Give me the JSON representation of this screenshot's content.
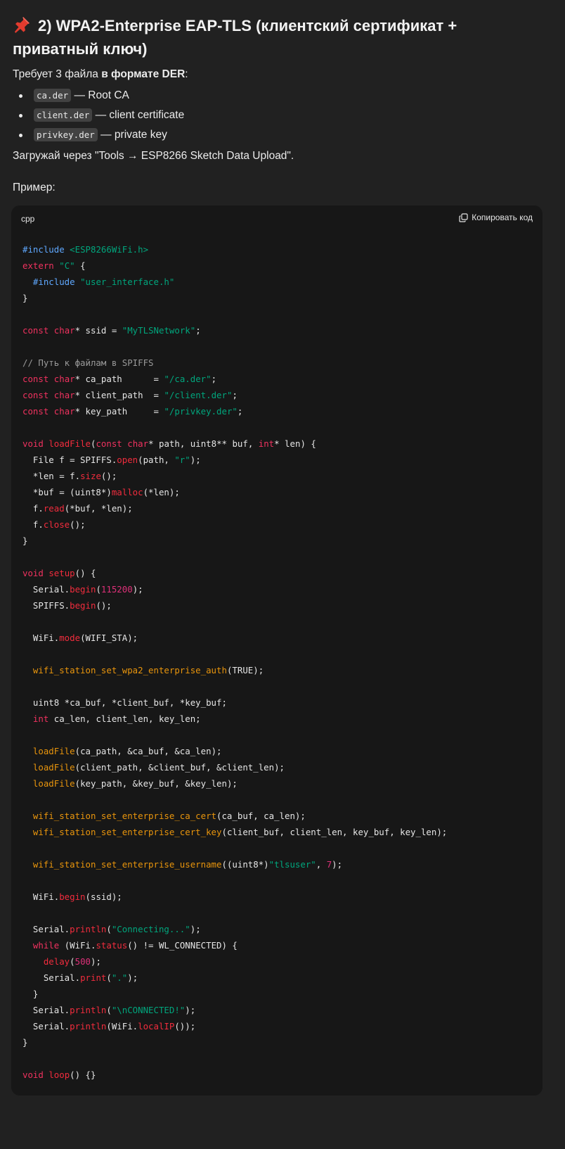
{
  "heading": {
    "icon": "pushpin-icon",
    "text": "2) WPA2-Enterprise EAP-TLS (клиентский сертификат + приватный ключ)"
  },
  "intro": {
    "prefix": "Требует 3 файла ",
    "bold": "в формате DER",
    "suffix": ":"
  },
  "files": [
    {
      "name": "ca.der",
      "desc": " — Root CA"
    },
    {
      "name": "client.der",
      "desc": " — client certificate"
    },
    {
      "name": "privkey.der",
      "desc": " — private key"
    }
  ],
  "upload_note": "Загружай через \"Tools → ESP8266 Sketch Data Upload\".",
  "example_label": "Пример:",
  "code_block": {
    "language": "cpp",
    "copy_label": "Копировать код",
    "lines": [
      "#include <ESP8266WiFi.h>",
      "extern \"C\" {",
      "  #include \"user_interface.h\"",
      "}",
      "",
      "const char* ssid = \"MyTLSNetwork\";",
      "",
      "// Путь к файлам в SPIFFS",
      "const char* ca_path      = \"/ca.der\";",
      "const char* client_path  = \"/client.der\";",
      "const char* key_path     = \"/privkey.der\";",
      "",
      "void loadFile(const char* path, uint8** buf, int* len) {",
      "  File f = SPIFFS.open(path, \"r\");",
      "  *len = f.size();",
      "  *buf = (uint8*)malloc(*len);",
      "  f.read(*buf, *len);",
      "  f.close();",
      "}",
      "",
      "void setup() {",
      "  Serial.begin(115200);",
      "  SPIFFS.begin();",
      "",
      "  WiFi.mode(WIFI_STA);",
      "",
      "  wifi_station_set_wpa2_enterprise_auth(TRUE);",
      "",
      "  uint8 *ca_buf, *client_buf, *key_buf;",
      "  int ca_len, client_len, key_len;",
      "",
      "  loadFile(ca_path, &ca_buf, &ca_len);",
      "  loadFile(client_path, &client_buf, &client_len);",
      "  loadFile(key_path, &key_buf, &key_len);",
      "",
      "  wifi_station_set_enterprise_ca_cert(ca_buf, ca_len);",
      "  wifi_station_set_enterprise_cert_key(client_buf, client_len, key_buf, key_len);",
      "",
      "  wifi_station_set_enterprise_username((uint8*)\"tlsuser\", 7);",
      "",
      "  WiFi.begin(ssid);",
      "",
      "  Serial.println(\"Connecting...\");",
      "  while (WiFi.status() != WL_CONNECTED) {",
      "    delay(500);",
      "    Serial.print(\".\");",
      "  }",
      "  Serial.println(\"\\nCONNECTED!\");",
      "  Serial.println(WiFi.localIP());",
      "}",
      "",
      "void loop() {}"
    ]
  }
}
